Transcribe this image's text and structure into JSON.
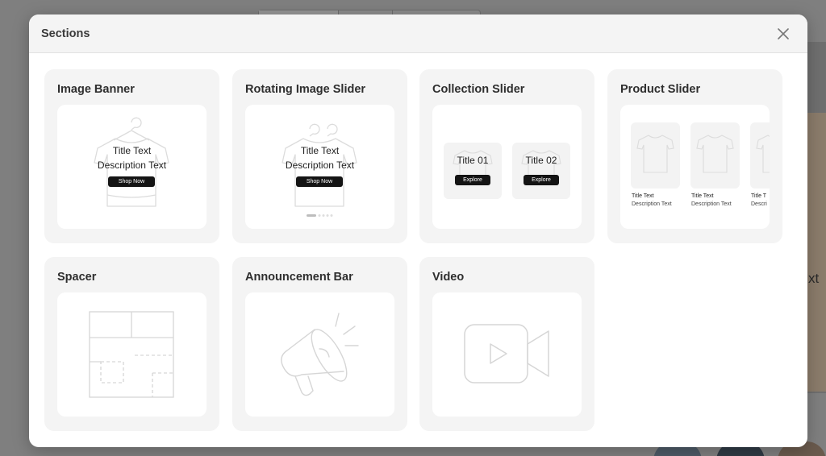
{
  "modal": {
    "title": "Sections",
    "close_icon": "close-icon"
  },
  "sections": [
    {
      "id": "image-banner",
      "title": "Image Banner",
      "preview": {
        "title": "Title Text",
        "description": "Description Text",
        "button": "Shop Now"
      }
    },
    {
      "id": "rotating-image-slider",
      "title": "Rotating Image Slider",
      "preview": {
        "title": "Title Text",
        "description": "Description Text",
        "button": "Shop Now"
      }
    },
    {
      "id": "collection-slider",
      "title": "Collection Slider",
      "preview": {
        "items": [
          {
            "title": "Title 01",
            "button": "Explore"
          },
          {
            "title": "Title 02",
            "button": "Explore"
          }
        ]
      }
    },
    {
      "id": "product-slider",
      "title": "Product Slider",
      "preview": {
        "items": [
          {
            "title": "Title Text",
            "description": "Description Text"
          },
          {
            "title": "Title Text",
            "description": "Description Text"
          },
          {
            "title": "Title T",
            "description": "Descri"
          }
        ]
      }
    },
    {
      "id": "spacer",
      "title": "Spacer",
      "preview": {
        "icon": "layout-grid-icon"
      }
    },
    {
      "id": "announcement-bar",
      "title": "Announcement Bar",
      "preview": {
        "icon": "megaphone-icon"
      }
    },
    {
      "id": "video",
      "title": "Video",
      "preview": {
        "icon": "video-camera-icon"
      }
    }
  ],
  "background": {
    "visible_text": "xt"
  },
  "colors": {
    "overlay": "#7f7f7f",
    "modal_bg": "#ffffff",
    "header_bg": "#f4f4f4",
    "card_bg": "#f4f4f4",
    "preview_bg": "#ffffff",
    "icon_stroke": "#d4d4d4",
    "button_bg": "#141414"
  }
}
